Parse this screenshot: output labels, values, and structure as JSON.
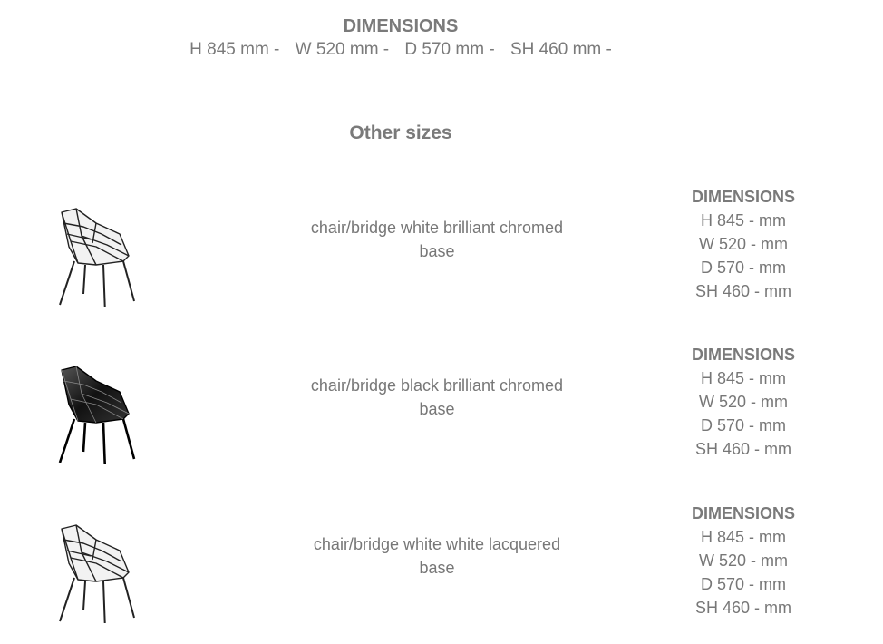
{
  "main": {
    "title": "DIMENSIONS",
    "values": [
      "H 845 mm -",
      "W 520 mm -",
      "D 570 mm -",
      "SH 460 mm -"
    ]
  },
  "other_sizes_title": "Other sizes",
  "variants": [
    {
      "description_line1": "chair/bridge white brilliant chromed",
      "description_line2": "base",
      "color": "white",
      "dims_title": "DIMENSIONS",
      "h": "H 845 - mm",
      "w": "W 520 - mm",
      "d": "D 570 - mm",
      "sh": "SH 460 - mm"
    },
    {
      "description_line1": "chair/bridge black brilliant chromed",
      "description_line2": "base",
      "color": "black",
      "dims_title": "DIMENSIONS",
      "h": "H 845 - mm",
      "w": "W 520 - mm",
      "d": "D 570 - mm",
      "sh": "SH 460 - mm"
    },
    {
      "description_line1": "chair/bridge white white lacquered",
      "description_line2": "base",
      "color": "white",
      "dims_title": "DIMENSIONS",
      "h": "H 845 - mm",
      "w": "W 520 - mm",
      "d": "D 570 - mm",
      "sh": "SH 460 - mm"
    }
  ]
}
